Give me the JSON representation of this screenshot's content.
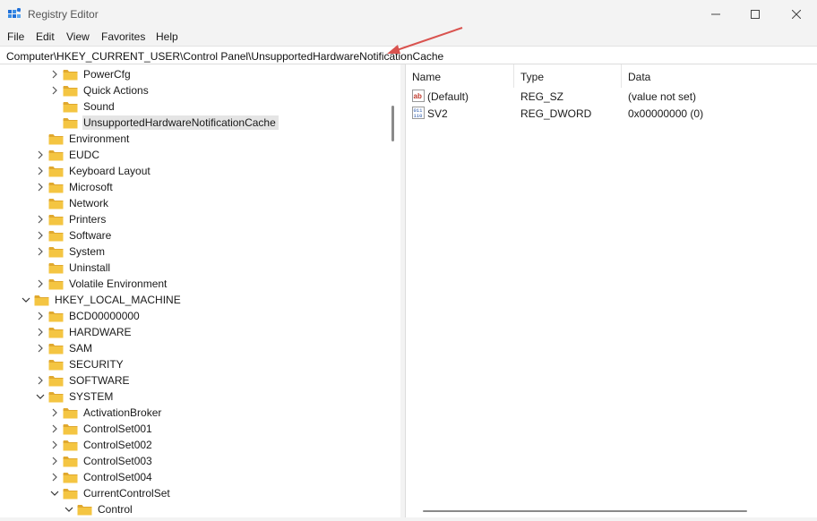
{
  "window": {
    "title": "Registry Editor",
    "minimize_icon": "minimize-icon",
    "maximize_icon": "maximize-icon",
    "close_icon": "close-icon"
  },
  "menu": [
    "File",
    "Edit",
    "View",
    "Favorites",
    "Help"
  ],
  "address": "Computer\\HKEY_CURRENT_USER\\Control Panel\\UnsupportedHardwareNotificationCache",
  "tree": [
    {
      "label": "PowerCfg",
      "depth": 3,
      "expander": "collapsed"
    },
    {
      "label": "Quick Actions",
      "depth": 3,
      "expander": "collapsed"
    },
    {
      "label": "Sound",
      "depth": 3,
      "expander": "none"
    },
    {
      "label": "UnsupportedHardwareNotificationCache",
      "depth": 3,
      "expander": "none",
      "selected": true
    },
    {
      "label": "Environment",
      "depth": 2,
      "expander": "none"
    },
    {
      "label": "EUDC",
      "depth": 2,
      "expander": "collapsed"
    },
    {
      "label": "Keyboard Layout",
      "depth": 2,
      "expander": "collapsed"
    },
    {
      "label": "Microsoft",
      "depth": 2,
      "expander": "collapsed"
    },
    {
      "label": "Network",
      "depth": 2,
      "expander": "none"
    },
    {
      "label": "Printers",
      "depth": 2,
      "expander": "collapsed"
    },
    {
      "label": "Software",
      "depth": 2,
      "expander": "collapsed"
    },
    {
      "label": "System",
      "depth": 2,
      "expander": "collapsed"
    },
    {
      "label": "Uninstall",
      "depth": 2,
      "expander": "none"
    },
    {
      "label": "Volatile Environment",
      "depth": 2,
      "expander": "collapsed"
    },
    {
      "label": "HKEY_LOCAL_MACHINE",
      "depth": 1,
      "expander": "expanded"
    },
    {
      "label": "BCD00000000",
      "depth": 2,
      "expander": "collapsed"
    },
    {
      "label": "HARDWARE",
      "depth": 2,
      "expander": "collapsed"
    },
    {
      "label": "SAM",
      "depth": 2,
      "expander": "collapsed"
    },
    {
      "label": "SECURITY",
      "depth": 2,
      "expander": "none"
    },
    {
      "label": "SOFTWARE",
      "depth": 2,
      "expander": "collapsed"
    },
    {
      "label": "SYSTEM",
      "depth": 2,
      "expander": "expanded"
    },
    {
      "label": "ActivationBroker",
      "depth": 3,
      "expander": "collapsed"
    },
    {
      "label": "ControlSet001",
      "depth": 3,
      "expander": "collapsed"
    },
    {
      "label": "ControlSet002",
      "depth": 3,
      "expander": "collapsed"
    },
    {
      "label": "ControlSet003",
      "depth": 3,
      "expander": "collapsed"
    },
    {
      "label": "ControlSet004",
      "depth": 3,
      "expander": "collapsed"
    },
    {
      "label": "CurrentControlSet",
      "depth": 3,
      "expander": "expanded"
    },
    {
      "label": "Control",
      "depth": 4,
      "expander": "expanded"
    }
  ],
  "columns": {
    "name": "Name",
    "type": "Type",
    "data": "Data"
  },
  "values": [
    {
      "name": "(Default)",
      "type": "REG_SZ",
      "data": "(value not set)",
      "icon": "string-value-icon"
    },
    {
      "name": "SV2",
      "type": "REG_DWORD",
      "data": "0x00000000 (0)",
      "icon": "binary-value-icon"
    }
  ],
  "colors": {
    "folder": "#f4c542",
    "folder_dark": "#e0a82e",
    "selection": "#e5e5e5",
    "annotation_arrow": "#d9534f"
  }
}
